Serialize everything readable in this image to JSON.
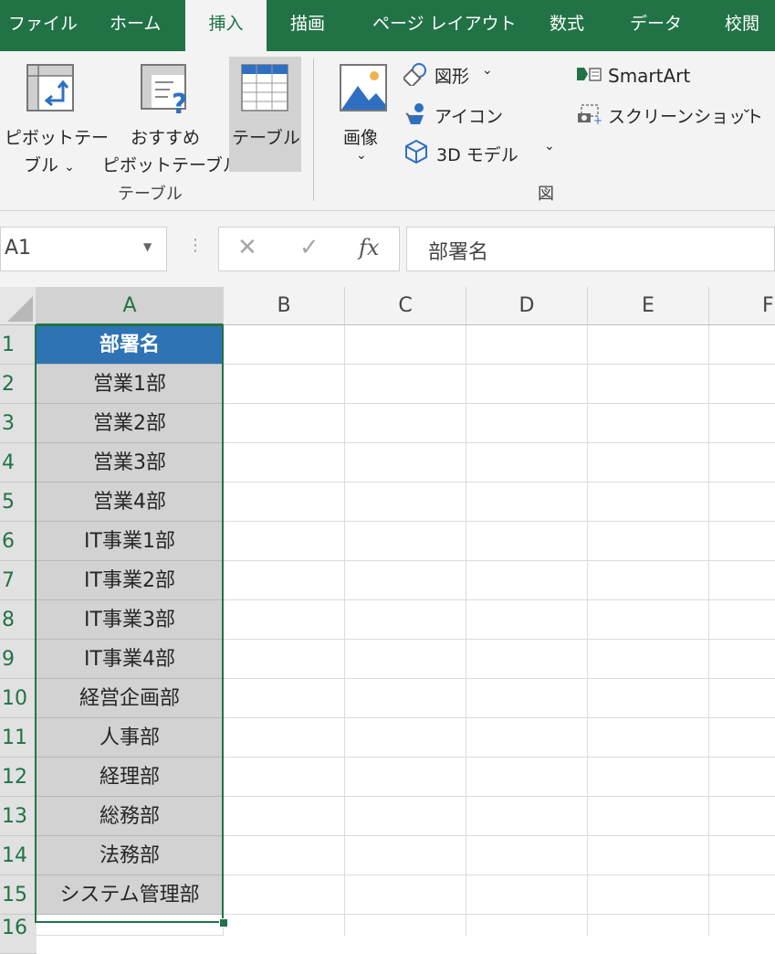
{
  "tabs": [
    "ファイル",
    "ホーム",
    "挿入",
    "描画",
    "ページ レイアウト",
    "数式",
    "データ",
    "校閲"
  ],
  "active_tab": "挿入",
  "ribbon": {
    "pivot_table_line1": "ピボットテー",
    "pivot_table_line2": "ブル",
    "recommended_pivot_line1": "おすすめ",
    "recommended_pivot_line2": "ピボットテーブル",
    "table": "テーブル",
    "group_tables": "テーブル",
    "pictures": "画像",
    "shapes": "図形",
    "icons": "アイコン",
    "models_3d": "3D モデル",
    "smartart": "SmartArt",
    "screenshot": "スクリーンショット",
    "group_illustrations": "図"
  },
  "formula_bar": {
    "name_box": "A1",
    "fx": "fx",
    "content": "部署名"
  },
  "grid": {
    "columns": [
      "A",
      "B",
      "C",
      "D",
      "E",
      "F"
    ],
    "selected_column": "A",
    "rows": [
      "1",
      "2",
      "3",
      "4",
      "5",
      "6",
      "7",
      "8",
      "9",
      "10",
      "11",
      "12",
      "13",
      "14",
      "15",
      "16"
    ],
    "column_a": [
      "部署名",
      "営業1部",
      "営業2部",
      "営業3部",
      "営業4部",
      "IT事業1部",
      "IT事業2部",
      "IT事業3部",
      "IT事業4部",
      "経営企画部",
      "人事部",
      "経理部",
      "総務部",
      "法務部",
      "システム管理部"
    ]
  },
  "colors": {
    "brand_green": "#217346",
    "header_blue": "#2e74b5",
    "selection_gray": "#d2d2d2"
  }
}
